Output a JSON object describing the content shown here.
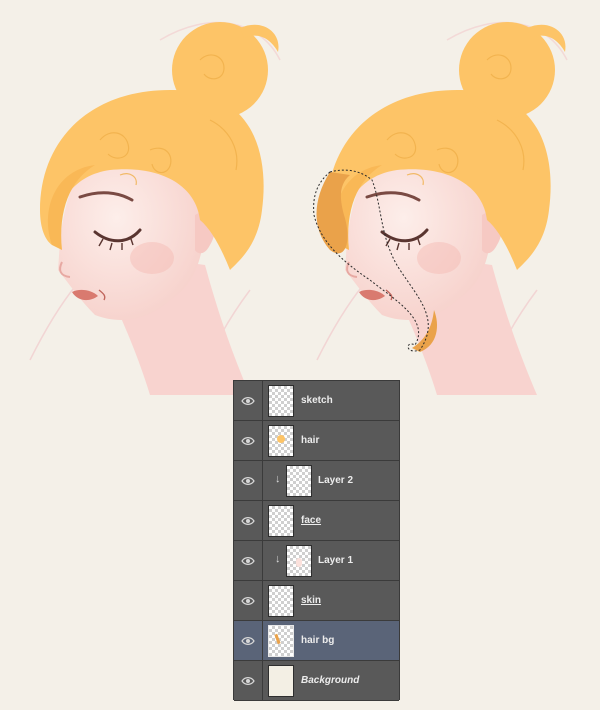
{
  "colors": {
    "background": "#f4f0e8",
    "hair": "#fdc467",
    "hair_selection": "#eaa24a",
    "skin": "#fbe1dc",
    "panel": "#565656",
    "selected_row": "#5a6478"
  },
  "layers_panel": {
    "layers": [
      {
        "name": "sketch",
        "visible_icon": "eye-icon",
        "thumb": "transparent",
        "clipped": false,
        "style": "bold",
        "selected": false
      },
      {
        "name": "hair",
        "visible_icon": "eye-icon",
        "thumb": "transparent-hair",
        "clipped": false,
        "style": "bold",
        "selected": false
      },
      {
        "name": "Layer 2",
        "visible_icon": "eye-icon",
        "thumb": "transparent",
        "clipped": true,
        "style": "bold",
        "selected": false
      },
      {
        "name": "face",
        "visible_icon": "eye-icon",
        "thumb": "transparent",
        "clipped": false,
        "style": "underline",
        "selected": false
      },
      {
        "name": "Layer 1",
        "visible_icon": "eye-icon",
        "thumb": "transparent-skin",
        "clipped": true,
        "style": "bold",
        "selected": false
      },
      {
        "name": "skin",
        "visible_icon": "eye-icon",
        "thumb": "transparent",
        "clipped": false,
        "style": "underline",
        "selected": false
      },
      {
        "name": "hair bg",
        "visible_icon": "eye-icon",
        "thumb": "transparent-sel",
        "clipped": false,
        "style": "bold",
        "selected": true
      },
      {
        "name": "Background",
        "visible_icon": "eye-icon",
        "thumb": "plain",
        "clipped": false,
        "style": "italic",
        "selected": false
      }
    ]
  }
}
